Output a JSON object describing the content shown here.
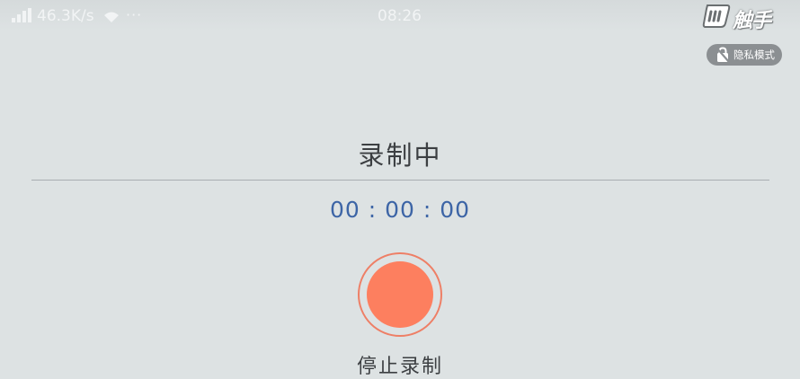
{
  "status_bar": {
    "network_speed": "46.3K/s",
    "more_icons": "···",
    "time": "08:26",
    "icons": [
      "signal-icon",
      "wifi-icon"
    ]
  },
  "brand": {
    "text": "触手",
    "icon": "brand-logo-icon"
  },
  "privacy_mode": {
    "label": "隐私模式",
    "icon": "privacy-lock-icon"
  },
  "recording": {
    "title": "录制中",
    "timer": "00 : 00 : 00",
    "stop_label": "停止录制",
    "button_color": "#fd7f5f",
    "ring_color": "#ee7f66",
    "timer_color": "#3d65a6"
  }
}
